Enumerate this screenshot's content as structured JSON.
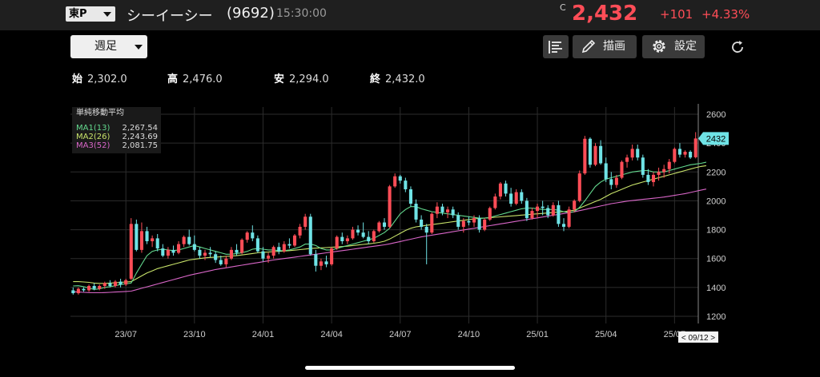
{
  "header": {
    "market": "東P",
    "name": "シーイーシー",
    "code": "(9692)",
    "time": "15:30:00",
    "price_prefix": "C",
    "price": "2,432",
    "change": "+101",
    "change_pct": "+4.33%"
  },
  "toolbar": {
    "period": "週足",
    "draw_label": "描画",
    "settings_label": "設定",
    "icons": [
      "list-icon",
      "pencil-icon",
      "gear-icon",
      "refresh-icon"
    ]
  },
  "ohlc": [
    {
      "label": "始",
      "value": "2,302.0"
    },
    {
      "label": "高",
      "value": "2,476.0"
    },
    {
      "label": "安",
      "value": "2,294.0"
    },
    {
      "label": "終",
      "value": "2,432.0"
    }
  ],
  "legend": {
    "title": "単純移動平均",
    "items": [
      {
        "name": "MA1(13)",
        "value": "2,267.54",
        "color": "#63d98e"
      },
      {
        "name": "MA2(26)",
        "value": "2,243.69",
        "color": "#c8e36a"
      },
      {
        "name": "MA3(52)",
        "value": "2,081.75",
        "color": "#d966c8"
      }
    ]
  },
  "colors": {
    "up": "#ff4d57",
    "down": "#6fe3e6",
    "background": "#000000",
    "grid": "#2c2c2c"
  },
  "chart_data": {
    "type": "candlestick",
    "ylim": [
      1150,
      2650
    ],
    "yticks": [
      1200,
      1400,
      1600,
      1800,
      2000,
      2200,
      2400,
      2600
    ],
    "xticks": [
      "23/07",
      "23/10",
      "24/01",
      "24/04",
      "24/07",
      "24/10",
      "25/01",
      "25/04",
      "25/07"
    ],
    "xtick_index": [
      10,
      23,
      36,
      49,
      62,
      75,
      88,
      101,
      114
    ],
    "current_price_label": "2432",
    "current_price": 2432,
    "date_label": "< 09/12 >",
    "candles": [
      [
        1380,
        1400,
        1350,
        1360
      ],
      [
        1360,
        1400,
        1350,
        1390
      ],
      [
        1390,
        1400,
        1370,
        1380
      ],
      [
        1380,
        1420,
        1370,
        1410
      ],
      [
        1410,
        1430,
        1380,
        1390
      ],
      [
        1390,
        1420,
        1380,
        1410
      ],
      [
        1410,
        1440,
        1390,
        1430
      ],
      [
        1430,
        1450,
        1400,
        1410
      ],
      [
        1410,
        1450,
        1400,
        1440
      ],
      [
        1440,
        1460,
        1400,
        1420
      ],
      [
        1420,
        1460,
        1410,
        1450
      ],
      [
        1460,
        1880,
        1450,
        1840
      ],
      [
        1840,
        1870,
        1650,
        1660
      ],
      [
        1660,
        1850,
        1640,
        1790
      ],
      [
        1790,
        1820,
        1700,
        1720
      ],
      [
        1720,
        1760,
        1680,
        1740
      ],
      [
        1740,
        1770,
        1650,
        1670
      ],
      [
        1670,
        1700,
        1610,
        1620
      ],
      [
        1620,
        1680,
        1600,
        1660
      ],
      [
        1660,
        1690,
        1620,
        1640
      ],
      [
        1640,
        1720,
        1630,
        1700
      ],
      [
        1700,
        1760,
        1680,
        1750
      ],
      [
        1750,
        1800,
        1690,
        1700
      ],
      [
        1700,
        1760,
        1650,
        1660
      ],
      [
        1660,
        1680,
        1600,
        1620
      ],
      [
        1620,
        1660,
        1590,
        1640
      ],
      [
        1640,
        1680,
        1610,
        1630
      ],
      [
        1630,
        1650,
        1570,
        1590
      ],
      [
        1590,
        1620,
        1550,
        1560
      ],
      [
        1560,
        1620,
        1540,
        1600
      ],
      [
        1600,
        1680,
        1590,
        1660
      ],
      [
        1660,
        1700,
        1620,
        1640
      ],
      [
        1640,
        1740,
        1630,
        1730
      ],
      [
        1730,
        1790,
        1710,
        1780
      ],
      [
        1780,
        1830,
        1720,
        1740
      ],
      [
        1740,
        1760,
        1640,
        1650
      ],
      [
        1650,
        1680,
        1580,
        1600
      ],
      [
        1600,
        1640,
        1570,
        1620
      ],
      [
        1620,
        1690,
        1600,
        1680
      ],
      [
        1680,
        1710,
        1630,
        1650
      ],
      [
        1650,
        1720,
        1640,
        1700
      ],
      [
        1700,
        1740,
        1670,
        1690
      ],
      [
        1690,
        1770,
        1680,
        1760
      ],
      [
        1760,
        1840,
        1740,
        1820
      ],
      [
        1820,
        1910,
        1800,
        1890
      ],
      [
        1890,
        1910,
        1620,
        1630
      ],
      [
        1630,
        1660,
        1510,
        1550
      ],
      [
        1550,
        1600,
        1520,
        1580
      ],
      [
        1580,
        1620,
        1540,
        1560
      ],
      [
        1560,
        1680,
        1550,
        1670
      ],
      [
        1670,
        1760,
        1660,
        1750
      ],
      [
        1750,
        1780,
        1700,
        1720
      ],
      [
        1720,
        1760,
        1700,
        1740
      ],
      [
        1740,
        1820,
        1730,
        1800
      ],
      [
        1800,
        1830,
        1760,
        1780
      ],
      [
        1780,
        1850,
        1740,
        1750
      ],
      [
        1750,
        1790,
        1700,
        1720
      ],
      [
        1720,
        1800,
        1710,
        1790
      ],
      [
        1790,
        1860,
        1780,
        1850
      ],
      [
        1850,
        1880,
        1800,
        1820
      ],
      [
        1820,
        2110,
        1810,
        2100
      ],
      [
        2100,
        2190,
        2090,
        2170
      ],
      [
        2170,
        2180,
        2120,
        2140
      ],
      [
        2140,
        2160,
        2060,
        2080
      ],
      [
        2080,
        2100,
        1960,
        1980
      ],
      [
        1980,
        2010,
        1850,
        1870
      ],
      [
        1870,
        1900,
        1800,
        1820
      ],
      [
        1820,
        1840,
        1560,
        1780
      ],
      [
        1780,
        1920,
        1770,
        1910
      ],
      [
        1910,
        1990,
        1880,
        1960
      ],
      [
        1960,
        1980,
        1900,
        1920
      ],
      [
        1920,
        1960,
        1880,
        1940
      ],
      [
        1940,
        1960,
        1880,
        1900
      ],
      [
        1900,
        1920,
        1800,
        1820
      ],
      [
        1820,
        1880,
        1780,
        1860
      ],
      [
        1860,
        1890,
        1830,
        1850
      ],
      [
        1850,
        1900,
        1820,
        1880
      ],
      [
        1880,
        1900,
        1780,
        1800
      ],
      [
        1800,
        1880,
        1790,
        1870
      ],
      [
        1870,
        1960,
        1860,
        1950
      ],
      [
        1950,
        2050,
        1940,
        2030
      ],
      [
        2030,
        2130,
        2010,
        2120
      ],
      [
        2120,
        2140,
        2030,
        2050
      ],
      [
        2050,
        2090,
        1960,
        1980
      ],
      [
        1980,
        2080,
        1970,
        2060
      ],
      [
        2060,
        2080,
        1980,
        2000
      ],
      [
        2000,
        2020,
        1860,
        1880
      ],
      [
        1880,
        1950,
        1870,
        1930
      ],
      [
        1930,
        1980,
        1880,
        1960
      ],
      [
        1960,
        2000,
        1900,
        1950
      ],
      [
        1950,
        1970,
        1880,
        1900
      ],
      [
        1900,
        1990,
        1890,
        1970
      ],
      [
        1970,
        2000,
        1820,
        1840
      ],
      [
        1840,
        1880,
        1790,
        1820
      ],
      [
        1820,
        1960,
        1810,
        1940
      ],
      [
        1940,
        2010,
        1920,
        2000
      ],
      [
        2000,
        2210,
        1990,
        2190
      ],
      [
        2190,
        2450,
        2180,
        2430
      ],
      [
        2430,
        2440,
        2230,
        2250
      ],
      [
        2250,
        2400,
        2240,
        2380
      ],
      [
        2380,
        2420,
        2250,
        2260
      ],
      [
        2260,
        2300,
        2130,
        2150
      ],
      [
        2150,
        2200,
        2080,
        2110
      ],
      [
        2110,
        2180,
        2090,
        2160
      ],
      [
        2160,
        2280,
        2150,
        2270
      ],
      [
        2270,
        2320,
        2230,
        2300
      ],
      [
        2300,
        2390,
        2280,
        2360
      ],
      [
        2360,
        2390,
        2280,
        2300
      ],
      [
        2300,
        2320,
        2160,
        2180
      ],
      [
        2180,
        2220,
        2110,
        2130
      ],
      [
        2130,
        2200,
        2100,
        2180
      ],
      [
        2180,
        2230,
        2140,
        2200
      ],
      [
        2200,
        2250,
        2160,
        2220
      ],
      [
        2220,
        2290,
        2190,
        2270
      ],
      [
        2270,
        2370,
        2260,
        2360
      ],
      [
        2360,
        2400,
        2300,
        2320
      ],
      [
        2320,
        2350,
        2300,
        2340
      ],
      [
        2340,
        2350,
        2290,
        2300
      ],
      [
        2302,
        2476,
        2294,
        2432
      ]
    ],
    "ma13": [
      1410,
      1412,
      1405,
      1395,
      1385,
      1390,
      1400,
      1405,
      1412,
      1420,
      1425,
      1430,
      1500,
      1560,
      1620,
      1650,
      1660,
      1665,
      1660,
      1655,
      1660,
      1670,
      1680,
      1690,
      1680,
      1670,
      1660,
      1650,
      1640,
      1630,
      1630,
      1635,
      1640,
      1650,
      1665,
      1670,
      1665,
      1660,
      1660,
      1655,
      1655,
      1660,
      1670,
      1680,
      1700,
      1700,
      1690,
      1670,
      1660,
      1660,
      1670,
      1680,
      1690,
      1700,
      1710,
      1720,
      1730,
      1740,
      1760,
      1780,
      1810,
      1860,
      1910,
      1940,
      1960,
      1960,
      1945,
      1935,
      1925,
      1920,
      1915,
      1910,
      1905,
      1900,
      1895,
      1890,
      1885,
      1880,
      1880,
      1885,
      1895,
      1905,
      1915,
      1925,
      1935,
      1945,
      1950,
      1950,
      1945,
      1940,
      1940,
      1940,
      1935,
      1925,
      1920,
      1925,
      1955,
      2000,
      2050,
      2100,
      2130,
      2150,
      2160,
      2170,
      2180,
      2190,
      2200,
      2205,
      2210,
      2210,
      2200,
      2200,
      2200,
      2210,
      2220,
      2230,
      2240,
      2250,
      2255,
      2260,
      2267.54
    ],
    "ma26": [
      1440,
      1440,
      1438,
      1435,
      1430,
      1428,
      1428,
      1430,
      1432,
      1435,
      1437,
      1440,
      1460,
      1480,
      1500,
      1515,
      1530,
      1540,
      1550,
      1560,
      1570,
      1580,
      1590,
      1595,
      1600,
      1605,
      1608,
      1610,
      1612,
      1615,
      1617,
      1620,
      1625,
      1630,
      1635,
      1640,
      1643,
      1645,
      1648,
      1650,
      1652,
      1655,
      1658,
      1662,
      1666,
      1670,
      1672,
      1674,
      1676,
      1678,
      1680,
      1683,
      1686,
      1690,
      1694,
      1698,
      1702,
      1706,
      1712,
      1720,
      1735,
      1755,
      1775,
      1795,
      1810,
      1820,
      1825,
      1830,
      1835,
      1840,
      1845,
      1850,
      1855,
      1860,
      1865,
      1870,
      1875,
      1878,
      1880,
      1883,
      1886,
      1889,
      1892,
      1895,
      1898,
      1901,
      1904,
      1907,
      1910,
      1913,
      1916,
      1919,
      1922,
      1925,
      1930,
      1935,
      1950,
      1965,
      1980,
      1995,
      2010,
      2030,
      2050,
      2065,
      2080,
      2095,
      2110,
      2120,
      2130,
      2140,
      2150,
      2160,
      2170,
      2180,
      2190,
      2200,
      2210,
      2220,
      2230,
      2238,
      2243.69
    ],
    "ma52": [
      1370,
      1368,
      1366,
      1364,
      1363,
      1363,
      1364,
      1366,
      1368,
      1370,
      1372,
      1374,
      1384,
      1394,
      1404,
      1414,
      1424,
      1434,
      1444,
      1454,
      1464,
      1474,
      1484,
      1492,
      1500,
      1508,
      1516,
      1524,
      1530,
      1536,
      1542,
      1548,
      1554,
      1560,
      1566,
      1572,
      1578,
      1584,
      1590,
      1595,
      1600,
      1605,
      1610,
      1615,
      1620,
      1625,
      1630,
      1635,
      1640,
      1645,
      1650,
      1655,
      1660,
      1665,
      1670,
      1675,
      1680,
      1685,
      1690,
      1695,
      1702,
      1710,
      1718,
      1726,
      1734,
      1742,
      1750,
      1756,
      1762,
      1768,
      1774,
      1780,
      1786,
      1792,
      1798,
      1804,
      1810,
      1816,
      1822,
      1828,
      1834,
      1840,
      1846,
      1852,
      1858,
      1864,
      1870,
      1876,
      1882,
      1888,
      1894,
      1900,
      1906,
      1912,
      1918,
      1924,
      1932,
      1940,
      1948,
      1956,
      1964,
      1972,
      1980,
      1986,
      1992,
      1998,
      2002,
      2006,
      2010,
      2014,
      2018,
      2022,
      2026,
      2032,
      2038,
      2044,
      2050,
      2058,
      2066,
      2074,
      2081.75
    ]
  }
}
